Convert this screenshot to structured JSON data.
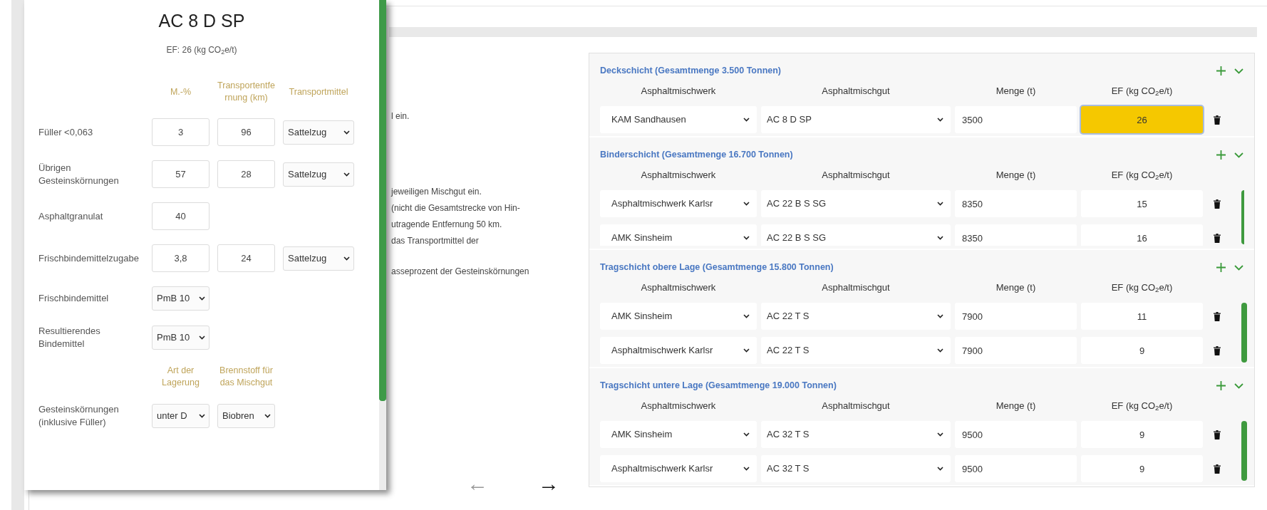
{
  "popup": {
    "title": "AC 8 D SP",
    "subtitle": "EF: 26 (kg CO$_{2}$e/t)",
    "rows": [
      {
        "kind": "header",
        "headings": [
          "M.-%",
          "Transportentfernung (km)",
          "Transportmittel"
        ]
      },
      {
        "kind": "fields",
        "label": "Füller <0,063",
        "cells": [
          {
            "kind": "input",
            "value": "3"
          },
          {
            "kind": "input",
            "value": "96"
          },
          {
            "kind": "select",
            "value": "Sattelzug"
          }
        ]
      },
      {
        "kind": "fields",
        "label": "Übrigen Gesteinskörnungen",
        "cells": [
          {
            "kind": "input",
            "value": "57"
          },
          {
            "kind": "input",
            "value": "28"
          },
          {
            "kind": "select",
            "value": "Sattelzug"
          }
        ]
      },
      {
        "kind": "fields",
        "label": "Asphaltgranulat",
        "cells": [
          {
            "kind": "input",
            "value": "40"
          }
        ]
      },
      {
        "kind": "fields",
        "label": "Frischbindemittelzugabe",
        "cells": [
          {
            "kind": "input",
            "value": "3,8"
          },
          {
            "kind": "input",
            "value": "24"
          },
          {
            "kind": "select",
            "value": "Sattelzug"
          }
        ]
      },
      {
        "kind": "fields",
        "label": "Frischbindemittel",
        "cells": [
          {
            "kind": "select",
            "value": "PmB 10"
          }
        ]
      },
      {
        "kind": "fields",
        "label": "Resultierendes Bindemittel",
        "cells": [
          {
            "kind": "select",
            "value": "PmB 10"
          }
        ]
      },
      {
        "kind": "header",
        "headings": [
          "Art der Lagerung",
          "Brennstoff für das Mischgut"
        ]
      },
      {
        "kind": "fields",
        "label": "Gesteinskörnungen (inklusive Füller)",
        "cells": [
          {
            "kind": "select",
            "value": "unter D"
          },
          {
            "kind": "select",
            "value": "Biobren"
          }
        ]
      }
    ]
  },
  "instructions": [
    {
      "lines": [
        "l ein."
      ]
    },
    {
      "lines": [
        "jeweiligen Mischgut ein.",
        "(nicht die Gesamtstrecke von Hin-",
        "utragende Entfernung 50 km.",
        "das Transportmittel der"
      ]
    },
    {
      "lines": [
        "asseprozent der Gesteinskörnungen"
      ]
    }
  ],
  "navigation": [
    {
      "symbol": "←",
      "disabled": true
    },
    {
      "symbol": "→",
      "disabled": false
    }
  ],
  "layers": [
    {
      "title": "Deckschicht (Gesamtmenge 3.500 Tonnen)",
      "columns": [
        "Asphaltmischwerk",
        "Asphaltmischgut",
        "Menge (t)",
        "EF (kg CO$_{2}$e/t)"
      ],
      "rows": [
        {
          "plant": "KAM Sandhausen",
          "mixture": "AC 8 D SP",
          "quantity": "3500",
          "ef": "26",
          "highlighted": true
        }
      ]
    },
    {
      "title": "Binderschicht (Gesamtmenge 16.700 Tonnen)",
      "columns": [
        "Asphaltmischwerk",
        "Asphaltmischgut",
        "Menge (t)",
        "EF (kg CO$_{2}$e/t)"
      ],
      "rows": [
        {
          "plant": "Asphaltmischwerk Karlsr",
          "mixture": "AC 22 B S SG",
          "quantity": "8350",
          "ef": "15",
          "highlighted": false
        },
        {
          "plant": "AMK Sinsheim",
          "mixture": "AC 22 B S SG",
          "quantity": "8350",
          "ef": "16",
          "highlighted": false
        }
      ]
    },
    {
      "title": "Tragschicht obere Lage (Gesamtmenge 15.800 Tonnen)",
      "columns": [
        "Asphaltmischwerk",
        "Asphaltmischgut",
        "Menge (t)",
        "EF (kg CO$_{2}$e/t)"
      ],
      "rows": [
        {
          "plant": "AMK Sinsheim",
          "mixture": "AC 22 T S",
          "quantity": "7900",
          "ef": "11",
          "highlighted": false
        },
        {
          "plant": "Asphaltmischwerk Karlsr",
          "mixture": "AC 22 T S",
          "quantity": "7900",
          "ef": "9",
          "highlighted": false
        }
      ]
    },
    {
      "title": "Tragschicht untere Lage (Gesamtmenge 19.000 Tonnen)",
      "columns": [
        "Asphaltmischwerk",
        "Asphaltmischgut",
        "Menge (t)",
        "EF (kg CO$_{2}$e/t)"
      ],
      "rows": [
        {
          "plant": "AMK Sinsheim",
          "mixture": "AC 32 T S",
          "quantity": "9500",
          "ef": "9",
          "highlighted": false
        },
        {
          "plant": "Asphaltmischwerk Karlsr",
          "mixture": "AC 32 T S",
          "quantity": "9500",
          "ef": "9",
          "highlighted": false
        }
      ]
    }
  ]
}
